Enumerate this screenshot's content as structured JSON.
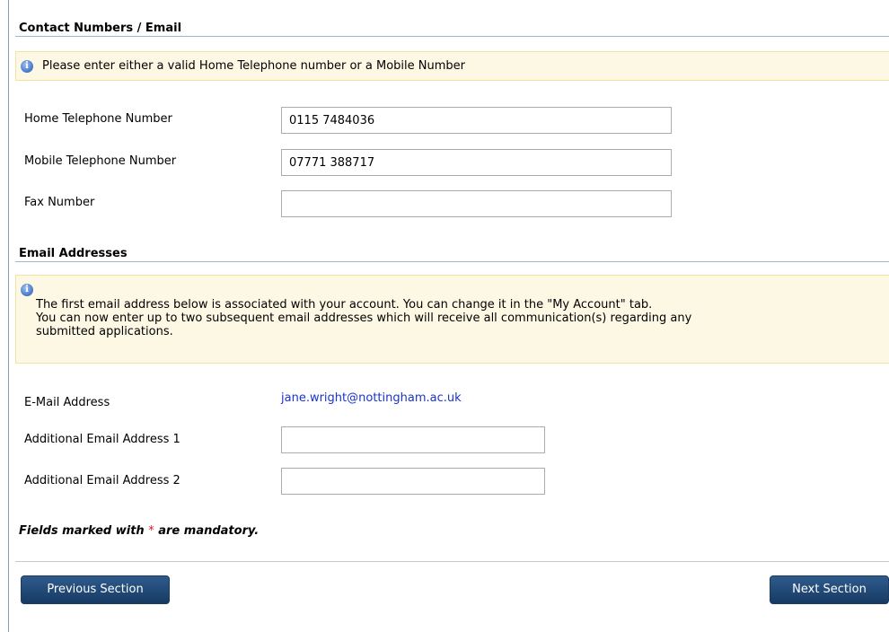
{
  "contact_section": {
    "title": "Contact Numbers / Email",
    "info": "Please enter either a valid Home Telephone number or a Mobile Number",
    "home_phone": {
      "label": "Home Telephone Number",
      "value": "0115 7484036"
    },
    "mobile_phone": {
      "label": "Mobile Telephone Number",
      "value": "07771 388717"
    },
    "fax": {
      "label": "Fax Number",
      "value": ""
    }
  },
  "email_section": {
    "title": "Email Addresses",
    "info_line1": "The first email address below is associated with your account. You can change it in the \"My Account\" tab.",
    "info_line2": "You can now enter up to two subsequent email addresses which will receive all communication(s) regarding any",
    "info_line3": "submitted applications.",
    "primary_email": {
      "label": "E-Mail Address",
      "value": "jane.wright@nottingham.ac.uk"
    },
    "additional_1": {
      "label": "Additional Email Address 1",
      "value": ""
    },
    "additional_2": {
      "label": "Additional Email Address 2",
      "value": ""
    }
  },
  "mandatory_note": {
    "prefix": "Fields marked with",
    "star": "*",
    "suffix": "are mandatory."
  },
  "nav": {
    "previous_label": "Previous Section",
    "next_label": "Next Section"
  },
  "icons": {
    "info": "info-icon"
  },
  "colors": {
    "accent": "#173a63",
    "info_bg": "#fdf8e4",
    "link": "#1a33cc",
    "required": "#e01a1a"
  }
}
